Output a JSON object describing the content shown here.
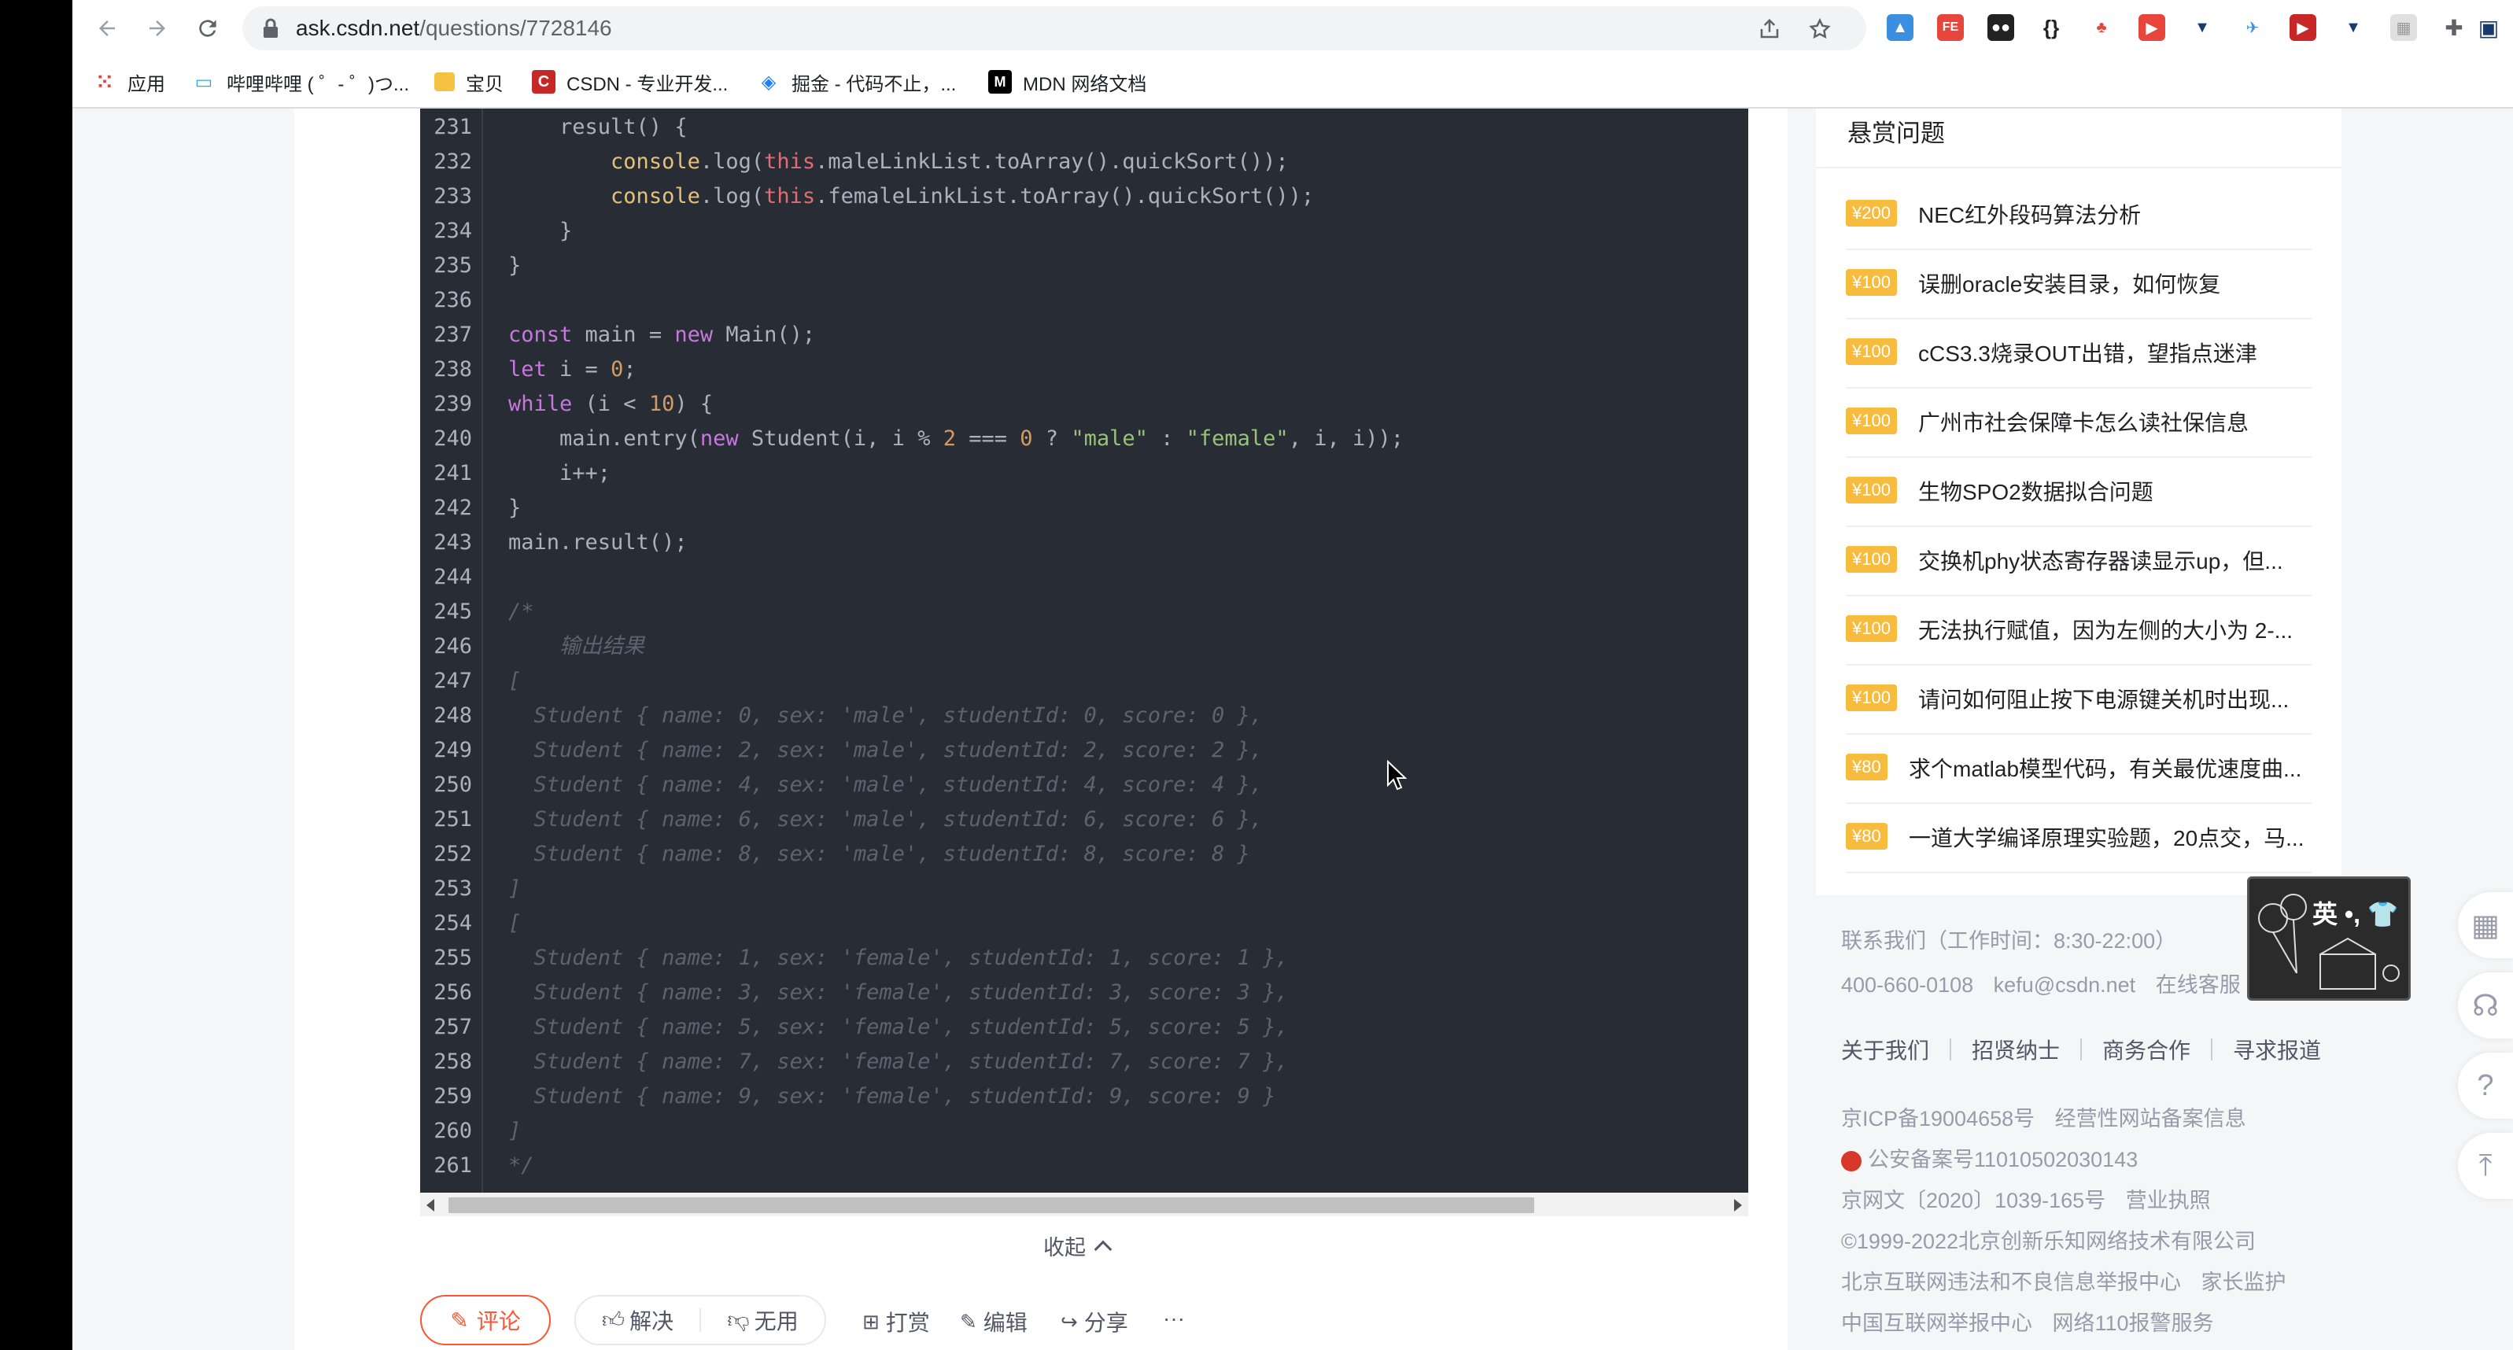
{
  "browser": {
    "url_host": "ask.csdn.net",
    "url_path": "/questions/7728146",
    "bookmarks": [
      {
        "label": "应用",
        "icon": "apps-grid-icon"
      },
      {
        "label": "哔哩哔哩 ( ゜- ゜)つ...",
        "icon": "bilibili-icon"
      },
      {
        "label": "宝贝",
        "icon": "folder-icon"
      },
      {
        "label": "CSDN - 专业开发...",
        "icon": "csdn-icon"
      },
      {
        "label": "掘金 - 代码不止，...",
        "icon": "juejin-icon"
      },
      {
        "label": "MDN 网络文档",
        "icon": "mdn-icon"
      }
    ]
  },
  "code": {
    "lines": [
      {
        "n": "231",
        "html": "    result() {"
      },
      {
        "n": "232",
        "html": "        <span class='fn'>console</span>.log(<span class='this'>this</span>.maleLinkList.toArray().quickSort());"
      },
      {
        "n": "233",
        "html": "        <span class='fn'>console</span>.log(<span class='this'>this</span>.femaleLinkList.toArray().quickSort());"
      },
      {
        "n": "234",
        "html": "    }"
      },
      {
        "n": "235",
        "html": "}"
      },
      {
        "n": "236",
        "html": ""
      },
      {
        "n": "237",
        "html": "<span class='kw'>const</span> main = <span class='kw'>new</span> Main();"
      },
      {
        "n": "238",
        "html": "<span class='kw'>let</span> i = <span class='num'>0</span>;"
      },
      {
        "n": "239",
        "html": "<span class='kw'>while</span> (i &lt; <span class='num'>10</span>) {"
      },
      {
        "n": "240",
        "html": "    main.entry(<span class='kw'>new</span> Student(i, i % <span class='num'>2</span> === <span class='num'>0</span> ? <span class='str'>\"male\"</span> : <span class='str'>\"female\"</span>, i, i));"
      },
      {
        "n": "241",
        "html": "    i++;"
      },
      {
        "n": "242",
        "html": "}"
      },
      {
        "n": "243",
        "html": "main.result();"
      },
      {
        "n": "244",
        "html": ""
      },
      {
        "n": "245",
        "html": "<span class='cm'>/*</span>"
      },
      {
        "n": "246",
        "html": "<span class='cm'>    输出结果</span>"
      },
      {
        "n": "247",
        "html": "<span class='cm'>[</span>"
      },
      {
        "n": "248",
        "html": "<span class='cm'>  Student { name: 0, sex: 'male', studentId: 0, score: 0 },</span>"
      },
      {
        "n": "249",
        "html": "<span class='cm'>  Student { name: 2, sex: 'male', studentId: 2, score: 2 },</span>"
      },
      {
        "n": "250",
        "html": "<span class='cm'>  Student { name: 4, sex: 'male', studentId: 4, score: 4 },</span>"
      },
      {
        "n": "251",
        "html": "<span class='cm'>  Student { name: 6, sex: 'male', studentId: 6, score: 6 },</span>"
      },
      {
        "n": "252",
        "html": "<span class='cm'>  Student { name: 8, sex: 'male', studentId: 8, score: 8 }</span>"
      },
      {
        "n": "253",
        "html": "<span class='cm'>]</span>"
      },
      {
        "n": "254",
        "html": "<span class='cm'>[</span>"
      },
      {
        "n": "255",
        "html": "<span class='cm'>  Student { name: 1, sex: 'female', studentId: 1, score: 1 },</span>"
      },
      {
        "n": "256",
        "html": "<span class='cm'>  Student { name: 3, sex: 'female', studentId: 3, score: 3 },</span>"
      },
      {
        "n": "257",
        "html": "<span class='cm'>  Student { name: 5, sex: 'female', studentId: 5, score: 5 },</span>"
      },
      {
        "n": "258",
        "html": "<span class='cm'>  Student { name: 7, sex: 'female', studentId: 7, score: 7 },</span>"
      },
      {
        "n": "259",
        "html": "<span class='cm'>  Student { name: 9, sex: 'female', studentId: 9, score: 9 }</span>"
      },
      {
        "n": "260",
        "html": "<span class='cm'>]</span>"
      },
      {
        "n": "261",
        "html": "<span class='cm'>*/</span>"
      }
    ]
  },
  "collapse_label": "收起",
  "actions": {
    "comment": "评论",
    "solve": "解决",
    "useless": "无用",
    "reward": "打赏",
    "edit": "编辑",
    "share": "分享",
    "more": "···"
  },
  "bounty": {
    "title": "悬赏问题",
    "items": [
      {
        "reward": "¥200",
        "question": "NEC红外段码算法分析"
      },
      {
        "reward": "¥100",
        "question": "误删oracle安装目录，如何恢复"
      },
      {
        "reward": "¥100",
        "question": "cCS3.3烧录OUT出错，望指点迷津"
      },
      {
        "reward": "¥100",
        "question": "广州市社会保障卡怎么读社保信息"
      },
      {
        "reward": "¥100",
        "question": "生物SPO2数据拟合问题"
      },
      {
        "reward": "¥100",
        "question": "交换机phy状态寄存器读显示up，但..."
      },
      {
        "reward": "¥100",
        "question": "无法执行赋值，因为左侧的大小为 2-..."
      },
      {
        "reward": "¥100",
        "question": "请问如何阻止按下电源键关机时出现..."
      },
      {
        "reward": "¥80",
        "question": "求个matlab模型代码，有关最优速度曲..."
      },
      {
        "reward": "¥80",
        "question": "一道大学编译原理实验题，20点交，马..."
      }
    ]
  },
  "footer": {
    "contact": "联系我们（工作时间：8:30-22:00）",
    "phone": "400-660-0108",
    "email": "kefu@csdn.net",
    "online": "在线客服",
    "links": [
      "关于我们",
      "招贤纳士",
      "商务合作",
      "寻求报道"
    ],
    "icp": "京ICP备19004658号",
    "icp2": "经营性网站备案信息",
    "police": "公安备案号11010502030143",
    "wenwang": "京网文〔2020〕1039-165号",
    "license": "营业执照",
    "copyright": "©1999-2022北京创新乐知网络技术有限公司",
    "report1": "北京互联网违法和不良信息举报中心",
    "report2": "家长监护",
    "report3": "中国互联网举报中心",
    "report4": "网络110报警服务"
  },
  "sticker_text": "英 •, 👕",
  "colors": {
    "accent": "#fc5531",
    "badge": "#f7bb3e",
    "code_bg": "#282c34"
  }
}
